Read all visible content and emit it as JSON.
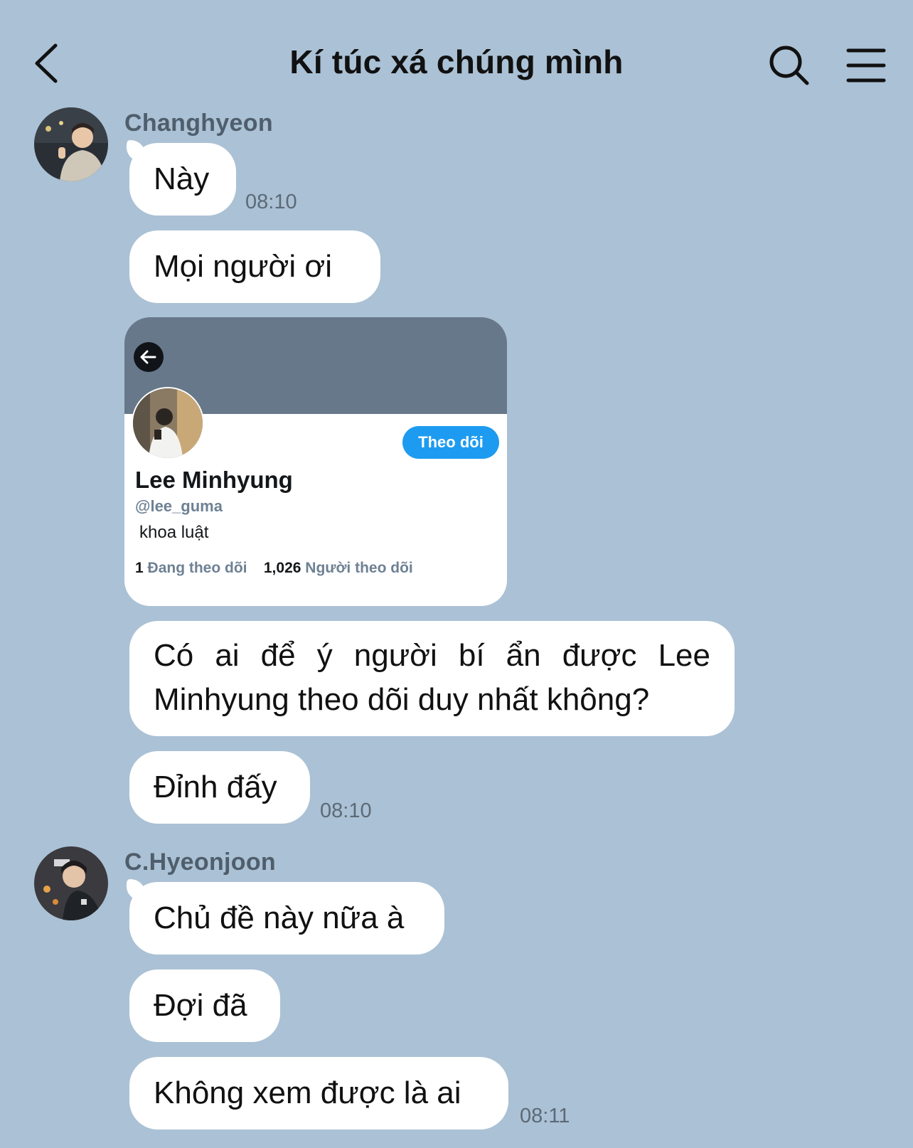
{
  "header": {
    "title": "Kí túc xá chúng mình"
  },
  "messages_group1": {
    "sender": "Changhyeon",
    "bubble1": "Này",
    "time1": "08:10",
    "bubble2": "Mọi người ơi",
    "bubble3": "Có ai để ý người bí ẩn được Lee Minhyung theo dõi duy nhất không?",
    "bubble4": "Đỉnh đấy",
    "time2": "08:10"
  },
  "profile_card": {
    "follow_label": "Theo dõi",
    "name": "Lee Minhyung",
    "handle": "@lee_guma",
    "bio": "khoa luật",
    "following_count": "1",
    "following_label": "Đang theo dõi",
    "followers_count": "1,026",
    "followers_label": "Người theo dõi"
  },
  "messages_group2": {
    "sender": "C.Hyeonjoon",
    "bubble1": "Chủ đề này nữa à",
    "bubble2": "Đợi đã",
    "bubble3": "Không xem được là ai",
    "time1": "08:11"
  },
  "icons": [
    "chevron-left-icon",
    "search-icon",
    "menu-icon",
    "arrow-left-icon"
  ],
  "colors": {
    "background": "#abc1d5",
    "bubble": "#ffffff",
    "follow_button": "#1d9bf0",
    "banner": "#67788a"
  }
}
